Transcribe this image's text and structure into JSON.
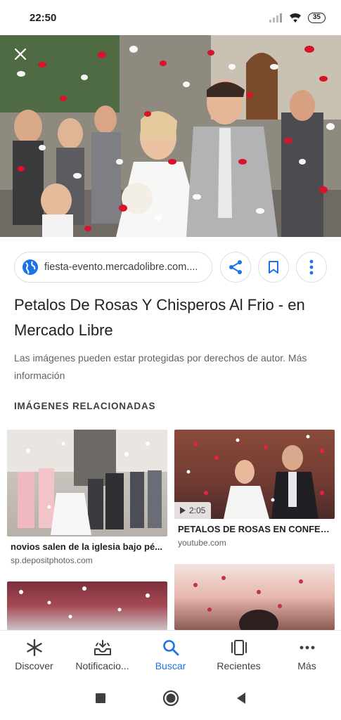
{
  "status_bar": {
    "time": "22:50",
    "battery": "35"
  },
  "hero": {
    "close_icon": "close-icon"
  },
  "source": {
    "url": "fiesta-evento.mercadolibre.com...."
  },
  "title": "Petalos De Rosas Y Chisperos Al Frio - en Mercado Libre",
  "disclaimer": "Las imágenes pueden estar protegidas por derechos de autor. Más información",
  "related": {
    "heading": "IMÁGENES RELACIONADAS",
    "items": [
      {
        "caption": "novios salen de la iglesia bajo pé...",
        "source": "sp.depositphotos.com"
      },
      {
        "caption": "PETALOS DE ROSAS EN CONFET...",
        "source": "youtube.com",
        "duration": "2:05"
      }
    ]
  },
  "bottom_nav": [
    {
      "label": "Discover",
      "icon": "asterisk-icon"
    },
    {
      "label": "Notificacio...",
      "icon": "inbox-icon"
    },
    {
      "label": "Buscar",
      "icon": "search-icon"
    },
    {
      "label": "Recientes",
      "icon": "recents-icon"
    },
    {
      "label": "Más",
      "icon": "more-horizontal-icon"
    }
  ],
  "colors": {
    "accent": "#1a73e8",
    "text": "#202124",
    "muted": "#5f6368",
    "border": "#dadce0"
  }
}
